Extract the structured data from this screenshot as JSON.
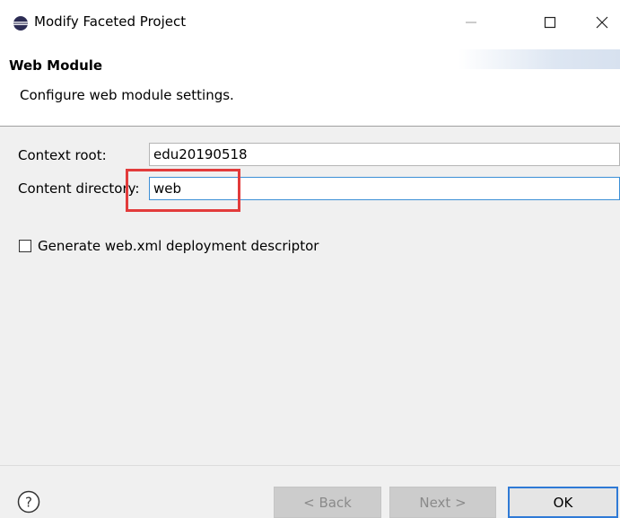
{
  "window": {
    "title": "Modify Faceted Project",
    "icon": "eclipse-icon",
    "minimize_glyph": "—",
    "maximize_glyph": "☐",
    "close_glyph": "✕"
  },
  "header": {
    "title": "Web Module",
    "description": "Configure web module settings."
  },
  "form": {
    "context_root_label": "Context root:",
    "context_root_value": "edu20190518",
    "content_directory_label": "Content directory:",
    "content_directory_value": "web",
    "generate_descriptor_label": "Generate web.xml deployment descriptor",
    "generate_descriptor_checked": false
  },
  "footer": {
    "help_glyph": "?",
    "back_label": "< Back",
    "next_label": "Next >",
    "ok_label": "OK"
  },
  "colors": {
    "accent": "#2f7ad6",
    "highlight": "#e23b3b",
    "panel": "#f0f0f0"
  }
}
